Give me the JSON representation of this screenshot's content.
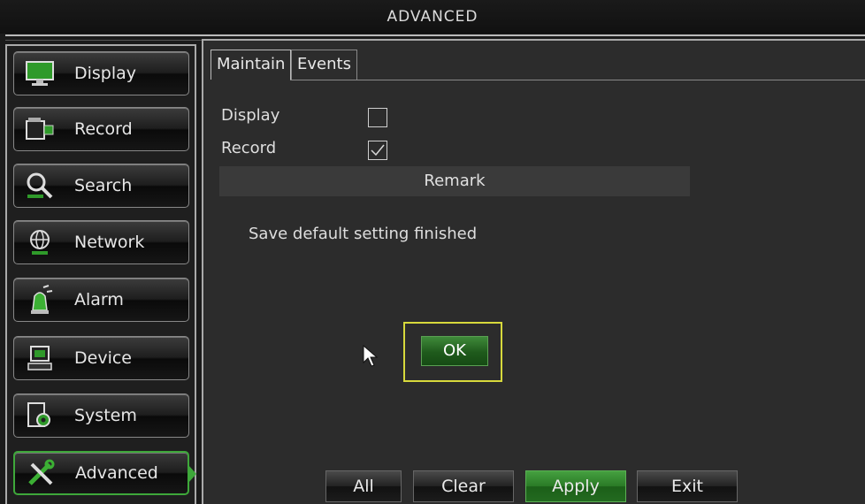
{
  "window": {
    "title": "ADVANCED"
  },
  "sidebar": {
    "items": [
      {
        "label": "Display",
        "icon": "monitor-icon"
      },
      {
        "label": "Record",
        "icon": "camera-icon"
      },
      {
        "label": "Search",
        "icon": "magnifier-icon"
      },
      {
        "label": "Network",
        "icon": "globe-icon"
      },
      {
        "label": "Alarm",
        "icon": "siren-icon"
      },
      {
        "label": "Device",
        "icon": "computer-icon"
      },
      {
        "label": "System",
        "icon": "gear-icon"
      },
      {
        "label": "Advanced",
        "icon": "tools-icon",
        "active": true
      }
    ]
  },
  "tabs": [
    {
      "label": "Maintain",
      "active": true
    },
    {
      "label": "Events"
    }
  ],
  "options": [
    {
      "label": "Display",
      "checked": false
    },
    {
      "label": "Record",
      "checked": true
    }
  ],
  "remark": {
    "label": "Remark"
  },
  "message": {
    "text": "Save default setting finished"
  },
  "dialog": {
    "ok_label": "OK"
  },
  "footer": {
    "all_label": "All",
    "clear_label": "Clear",
    "apply_label": "Apply",
    "exit_label": "Exit"
  },
  "colors": {
    "accent_green": "#3ea83a",
    "highlight_yellow": "#d7d93c"
  }
}
